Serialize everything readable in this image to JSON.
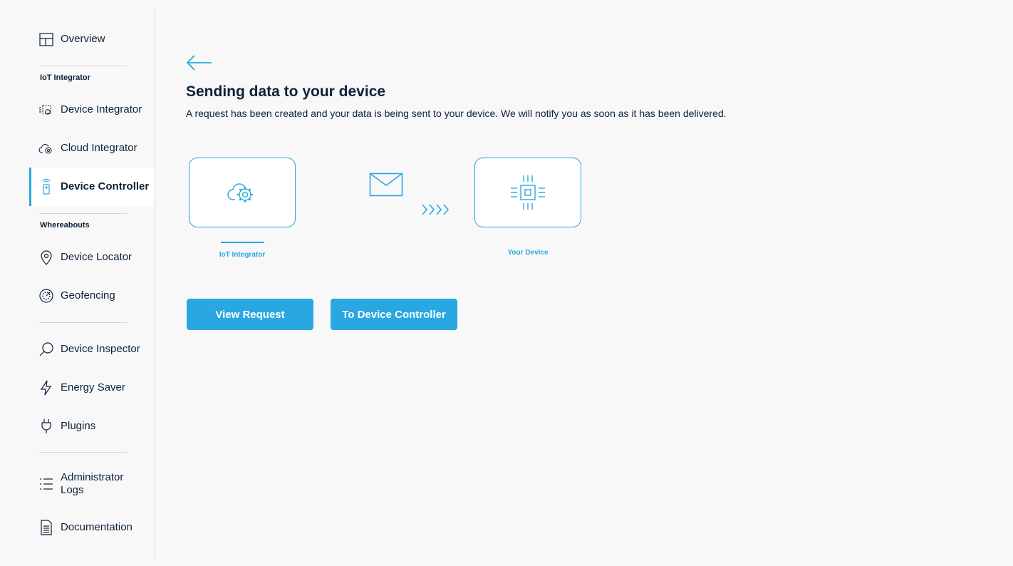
{
  "sidebar": {
    "overview": "Overview",
    "section_iot": "IoT Integrator",
    "device_integrator": "Device Integrator",
    "cloud_integrator": "Cloud Integrator",
    "device_controller": "Device Controller",
    "section_whereabouts": "Whereabouts",
    "device_locator": "Device Locator",
    "geofencing": "Geofencing",
    "device_inspector": "Device Inspector",
    "energy_saver": "Energy Saver",
    "plugins": "Plugins",
    "administrator_logs_1": "Administrator",
    "administrator_logs_2": "Logs",
    "documentation": "Documentation"
  },
  "main": {
    "title": "Sending data to your device",
    "description": "A request has been created and your data is being sent to your device. We will notify you as soon as it has been delivered.",
    "source_label": "IoT Integrator",
    "target_label": "Your Device",
    "view_request": "View Request",
    "to_device_controller": "To Device Controller"
  },
  "colors": {
    "accent": "#29a7e1",
    "text": "#0d2139",
    "background": "#f8f8f8"
  }
}
